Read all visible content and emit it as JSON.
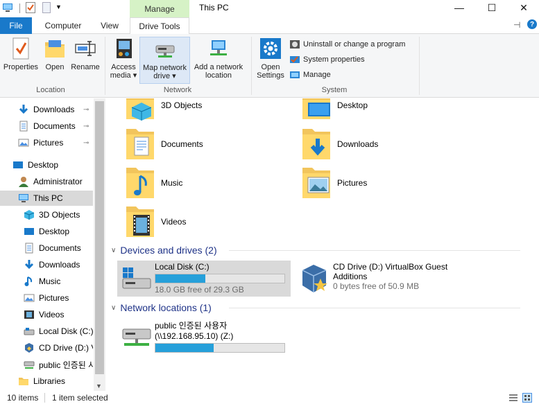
{
  "window": {
    "title": "This PC",
    "context_tab": "Manage",
    "minimize": "—",
    "maximize": "☐",
    "close": "✕"
  },
  "tabs": {
    "file": "File",
    "computer": "Computer",
    "view": "View",
    "drive_tools": "Drive Tools"
  },
  "ribbon": {
    "location": {
      "label": "Location",
      "properties": "Properties",
      "open": "Open",
      "rename": "Rename"
    },
    "network": {
      "label": "Network",
      "access_media_1": "Access",
      "access_media_2": "media ▾",
      "map_drive_1": "Map network",
      "map_drive_2": "drive ▾",
      "add_location_1": "Add a network",
      "add_location_2": "location"
    },
    "system": {
      "label": "System",
      "open_settings_1": "Open",
      "open_settings_2": "Settings",
      "uninstall": "Uninstall or change a program",
      "system_properties": "System properties",
      "manage": "Manage"
    }
  },
  "nav": {
    "items": [
      {
        "label": "Downloads",
        "pinned": true
      },
      {
        "label": "Documents",
        "pinned": true
      },
      {
        "label": "Pictures",
        "pinned": true
      },
      {
        "label": "Desktop"
      },
      {
        "label": "Administrator"
      },
      {
        "label": "This PC"
      },
      {
        "label": "3D Objects"
      },
      {
        "label": "Desktop"
      },
      {
        "label": "Documents"
      },
      {
        "label": "Downloads"
      },
      {
        "label": "Music"
      },
      {
        "label": "Pictures"
      },
      {
        "label": "Videos"
      },
      {
        "label": "Local Disk (C:)"
      },
      {
        "label": "CD Drive (D:) V"
      },
      {
        "label": "public 인증된 사"
      },
      {
        "label": "Libraries"
      }
    ]
  },
  "folders": [
    {
      "label": "3D Objects"
    },
    {
      "label": "Desktop"
    },
    {
      "label": "Documents"
    },
    {
      "label": "Downloads"
    },
    {
      "label": "Music"
    },
    {
      "label": "Pictures"
    },
    {
      "label": "Videos"
    }
  ],
  "devices": {
    "header": "Devices and drives (2)",
    "local_disk": {
      "name": "Local Disk (C:)",
      "free": "18.0 GB free of 29.3 GB",
      "used_fraction": 0.386
    },
    "cd_drive": {
      "name_1": "CD Drive (D:) VirtualBox Guest",
      "name_2": "Additions",
      "free": "0 bytes free of 50.9 MB"
    }
  },
  "network": {
    "header": "Network locations (1)",
    "drive": {
      "name_1": "public 인증된 사용자",
      "name_2": "(\\\\192.168.95.10) (Z:)",
      "used_fraction": 0.45
    }
  },
  "status": {
    "items": "10 items",
    "selected": "1 item selected"
  }
}
